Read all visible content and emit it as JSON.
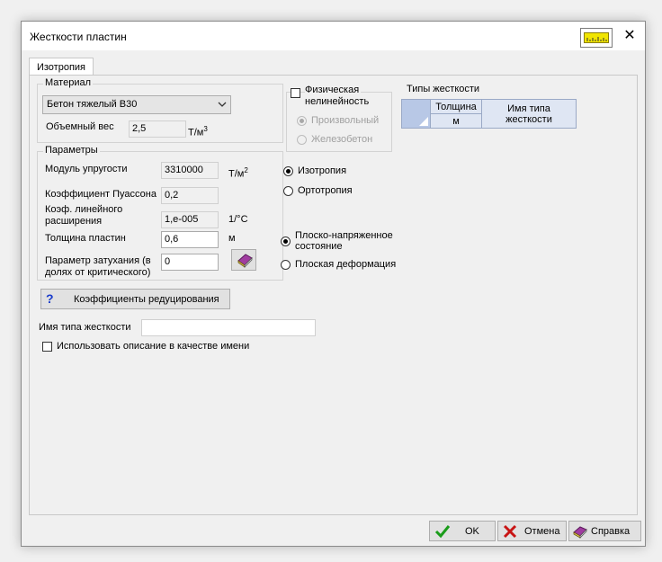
{
  "window": {
    "title": "Жесткости пластин",
    "ruler_icon": "ruler-icon",
    "close_glyph": "✕"
  },
  "tab": {
    "label": "Изотропия"
  },
  "material": {
    "legend": "Материал",
    "selected": "Бетон тяжелый В30",
    "weight_label": "Объемный вес",
    "weight_value": "2,5",
    "weight_unit": "Т/м",
    "weight_unit_sup": "3"
  },
  "params": {
    "legend": "Параметры",
    "modulus_label": "Модуль упругости",
    "modulus_value": "3310000",
    "modulus_unit": "Т/м",
    "modulus_unit_sup": "2",
    "poisson_label": "Коэффициент Пуассона",
    "poisson_value": "0,2",
    "expansion_label_1": "Коэф. линейного",
    "expansion_label_2": "расширения",
    "expansion_value": "1,e-005",
    "expansion_unit": "1/°С",
    "thickness_label": "Толщина пластин",
    "thickness_value": "0,6",
    "thickness_unit": "м",
    "damping_label_1": "Параметр затухания (в",
    "damping_label_2": "долях от критического)",
    "damping_value": "0",
    "book_icon": "book-icon"
  },
  "nonlinear": {
    "label_1": "Физическая",
    "label_2": "нелинейность",
    "checked": false,
    "option_1": "Произвольный",
    "option_2": "Железобетон"
  },
  "iso": {
    "option_1": "Изотропия",
    "option_2": "Ортотропия",
    "selected": "Изотропия"
  },
  "stress": {
    "option_1_line_1": "Плоско-напряженное",
    "option_1_line_2": "состояние",
    "option_2": "Плоская деформация",
    "selected": "Плоско-напряженное состояние"
  },
  "reduction_button": {
    "label": "Коэффициенты редуцирования",
    "icon": "help-icon"
  },
  "stiffness_types": {
    "title": "Типы жесткости",
    "columns": [
      {
        "header": "Толщина",
        "unit": "м"
      },
      {
        "header": "Имя типа",
        "unit": "жесткости"
      }
    ]
  },
  "stiffness_name": {
    "label": "Имя типа жесткости",
    "value": ""
  },
  "use_description": {
    "label": "Использовать описание в качестве имени",
    "checked": false
  },
  "buttons": {
    "ok": "OK",
    "cancel": "Отмена",
    "help": "Справка"
  },
  "colors": {
    "ok_check": "#1a9c1a",
    "cancel_x": "#c81414",
    "grid_header": "#dfe6f3",
    "grid_corner": "#b8c8e6"
  }
}
